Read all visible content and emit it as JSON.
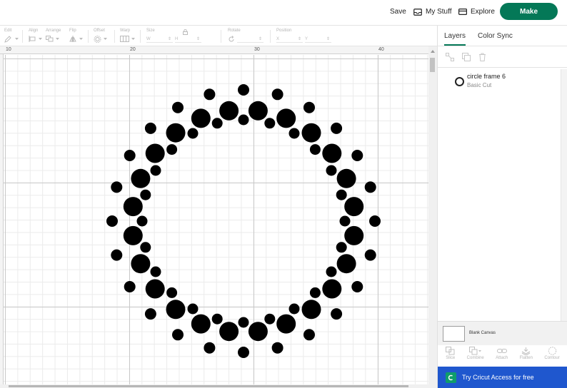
{
  "header": {
    "save_label": "Save",
    "mystuff_label": "My Stuff",
    "explore_label": "Explore",
    "make_label": "Make",
    "make_color": "#047857"
  },
  "toolbar": {
    "edit": "Edit",
    "align": "Align",
    "arrange": "Arrange",
    "flip": "Flip",
    "offset": "Offset",
    "warp": "Warp",
    "size": "Size",
    "size_w": "W",
    "size_h": "H",
    "rotate": "Rotate",
    "position": "Position",
    "position_x": "X",
    "position_y": "Y"
  },
  "ruler": {
    "top_numbers": [
      "10",
      "20",
      "30",
      "40"
    ]
  },
  "panel": {
    "tab_layers": "Layers",
    "tab_colorsync": "Color Sync",
    "layer_name": "circle frame 6",
    "layer_type": "Basic Cut",
    "blank_canvas": "Blank Canvas",
    "tools": [
      "Slice",
      "Combine",
      "Attach",
      "Flatten",
      "Contour"
    ],
    "banner_text": "Try Cricut Access for free",
    "banner_color": "#1f57ce"
  },
  "design": {
    "name": "circle frame 6",
    "fill": "#000000"
  }
}
